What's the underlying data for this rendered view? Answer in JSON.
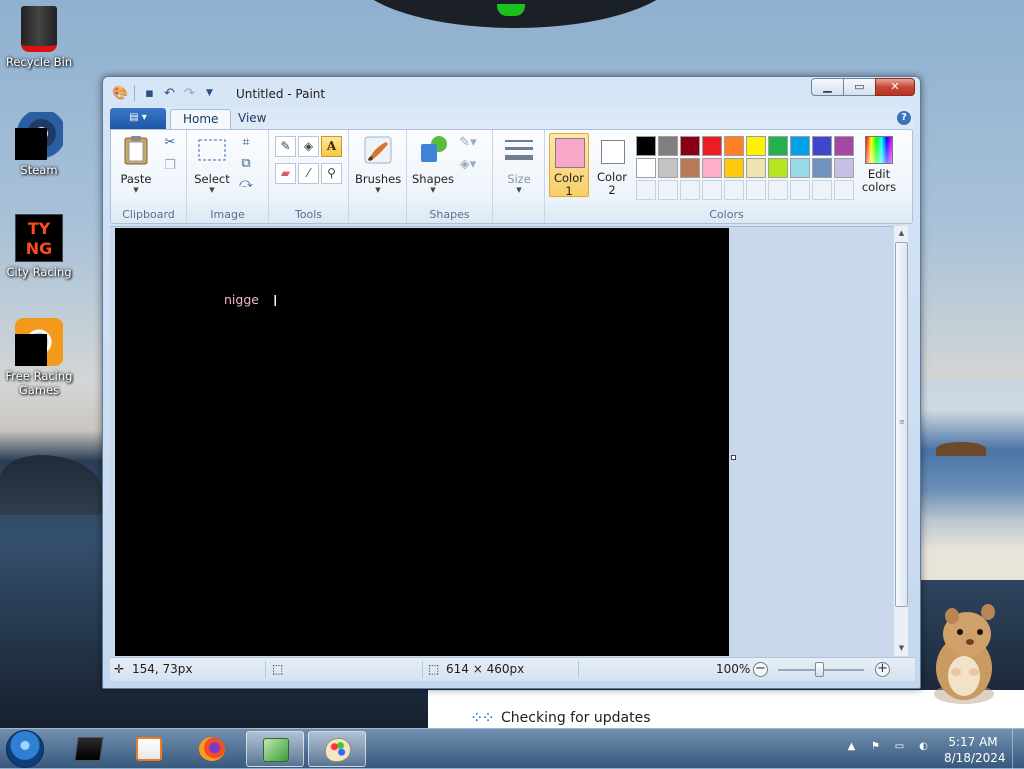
{
  "desktop": {
    "icons": [
      {
        "label": "Recycle Bin"
      },
      {
        "label": "Steam"
      },
      {
        "label": "City Racing",
        "art": "TY\nNG"
      },
      {
        "label": "Free Racing Games"
      }
    ],
    "update_notice": "Checking for updates"
  },
  "window": {
    "title": "Untitled - Paint",
    "tabs": [
      {
        "label": "Home"
      },
      {
        "label": "View"
      }
    ],
    "help": "?"
  },
  "ribbon": {
    "clipboard": {
      "label": "Clipboard",
      "paste": "Paste"
    },
    "image": {
      "label": "Image",
      "select": "Select"
    },
    "tools": {
      "label": "Tools",
      "text_tool": "A"
    },
    "brushes": "Brushes",
    "shapes": {
      "label": "Shapes",
      "button": "Shapes"
    },
    "size": "Size",
    "colors": {
      "label": "Colors",
      "color1": "Color\n1",
      "color2": "Color\n2",
      "color1_value": "#f7a8c9",
      "color2_value": "#ffffff",
      "edit": "Edit\ncolors",
      "palette": [
        "#000000",
        "#7f7f7f",
        "#880015",
        "#ed1c24",
        "#ff7f27",
        "#fff200",
        "#22b14c",
        "#00a2e8",
        "#3f48cc",
        "#a349a4",
        "#ffffff",
        "#c3c3c3",
        "#b97a57",
        "#ffaec9",
        "#ffc90e",
        "#efe4b0",
        "#b5e61d",
        "#99d9ea",
        "#7092be",
        "#c8bfe7"
      ]
    }
  },
  "canvas": {
    "text": "nigge",
    "background": "#000000",
    "text_color": "#f7b5d3"
  },
  "status": {
    "cursor": "154, 73px",
    "size": "614 × 460px",
    "zoom": "100%"
  },
  "taskbar": {
    "time": "5:17 AM",
    "date": "8/18/2024"
  }
}
